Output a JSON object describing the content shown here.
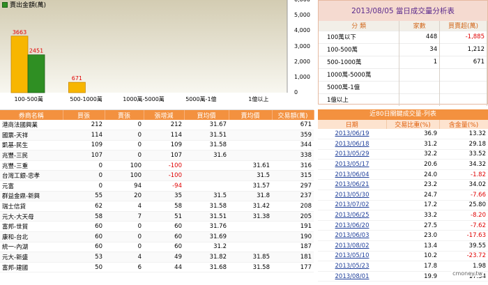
{
  "chart_data": {
    "type": "bar",
    "legend": "賣出金額(萬)",
    "categories": [
      "100-500萬",
      "500-1000萬",
      "1000萬-5000萬",
      "5000萬-1億",
      "1億以上"
    ],
    "series": [
      {
        "name": "series-orange",
        "color": "#f7b600",
        "values": [
          3663,
          671,
          0,
          0,
          0
        ]
      },
      {
        "name": "賣出金額(萬)",
        "color": "#2f8f23",
        "values": [
          2451,
          0,
          0,
          0,
          0
        ]
      }
    ],
    "data_labels": [
      "3663",
      "2451",
      "671"
    ],
    "y_ticks": [
      "6,000",
      "5,000",
      "4,000",
      "3,000",
      "2,000",
      "1,000",
      "0"
    ],
    "ylim": [
      0,
      6000
    ],
    "grid": false,
    "background_gradient": [
      "#d3ccb2",
      "#f8f7f0"
    ]
  },
  "summary": {
    "title": "2013/08/05 當日成交量分析表",
    "headers": [
      "分 類",
      "家數",
      "買賣超(萬)"
    ],
    "rows": [
      {
        "name": "100萬以下",
        "count": "448",
        "net": "-1,885"
      },
      {
        "name": "100-500萬",
        "count": "34",
        "net": "1,212"
      },
      {
        "name": "500-1000萬",
        "count": "1",
        "net": "671"
      },
      {
        "name": "1000萬-5000萬",
        "count": "",
        "net": ""
      },
      {
        "name": "5000萬-1億",
        "count": "",
        "net": ""
      },
      {
        "name": "1億以上",
        "count": "",
        "net": ""
      }
    ]
  },
  "brokers": {
    "headers": [
      "券商名稱",
      "買張",
      "賣張",
      "張增減",
      "買均價",
      "賣均價",
      "交易額(萬)"
    ],
    "rows": [
      [
        "港商法國興業",
        "212",
        "0",
        "212",
        "31.67",
        "",
        "671"
      ],
      [
        "國票-天祥",
        "114",
        "0",
        "114",
        "31.51",
        "",
        "359"
      ],
      [
        "凱基-民生",
        "109",
        "0",
        "109",
        "31.58",
        "",
        "344"
      ],
      [
        "兆豐-三民",
        "107",
        "0",
        "107",
        "31.6",
        "",
        "338"
      ],
      [
        "兆豐-三重",
        "0",
        "100",
        "-100",
        "",
        "31.61",
        "316"
      ],
      [
        "台灣工銀-忠孝",
        "0",
        "100",
        "-100",
        "",
        "31.5",
        "315"
      ],
      [
        "元富",
        "0",
        "94",
        "-94",
        "",
        "31.57",
        "297"
      ],
      [
        "群益金鼎-新興",
        "55",
        "20",
        "35",
        "31.5",
        "31.8",
        "237"
      ],
      [
        "瑞士信貸",
        "62",
        "4",
        "58",
        "31.58",
        "31.42",
        "208"
      ],
      [
        "元大-大天母",
        "58",
        "7",
        "51",
        "31.51",
        "31.38",
        "205"
      ],
      [
        "富邦-世貿",
        "60",
        "0",
        "60",
        "31.76",
        "",
        "191"
      ],
      [
        "康和-台北",
        "60",
        "0",
        "60",
        "31.69",
        "",
        "190"
      ],
      [
        "統一-內湖",
        "60",
        "0",
        "60",
        "31.2",
        "",
        "187"
      ],
      [
        "元大-新盛",
        "53",
        "4",
        "49",
        "31.82",
        "31.85",
        "181"
      ],
      [
        "富邦-建國",
        "50",
        "6",
        "44",
        "31.68",
        "31.58",
        "177"
      ]
    ]
  },
  "history": {
    "title": "近80日關鍵成交量-列表",
    "headers": [
      "日期",
      "交易比重(%)",
      "含金量(%)"
    ],
    "rows": [
      [
        "2013/06/19",
        "36.9",
        "13.32"
      ],
      [
        "2013/06/18",
        "31.2",
        "29.18"
      ],
      [
        "2013/05/29",
        "32.2",
        "33.52"
      ],
      [
        "2013/05/17",
        "20.6",
        "34.32"
      ],
      [
        "2013/06/04",
        "24.0",
        "-1.82"
      ],
      [
        "2013/06/21",
        "23.2",
        "34.02"
      ],
      [
        "2013/05/30",
        "24.7",
        "-7.66"
      ],
      [
        "2013/07/02",
        "17.2",
        "25.80"
      ],
      [
        "2013/06/25",
        "33.2",
        "-8.20"
      ],
      [
        "2013/06/20",
        "27.5",
        "-7.62"
      ],
      [
        "2013/06/03",
        "23.0",
        "-17.63"
      ],
      [
        "2013/08/02",
        "13.4",
        "39.55"
      ],
      [
        "2013/05/10",
        "10.2",
        "-23.72"
      ],
      [
        "2013/05/23",
        "17.8",
        "1.98"
      ],
      [
        "2013/08/01",
        "19.9",
        "17.34"
      ]
    ]
  },
  "watermark": "cmoney.tw"
}
